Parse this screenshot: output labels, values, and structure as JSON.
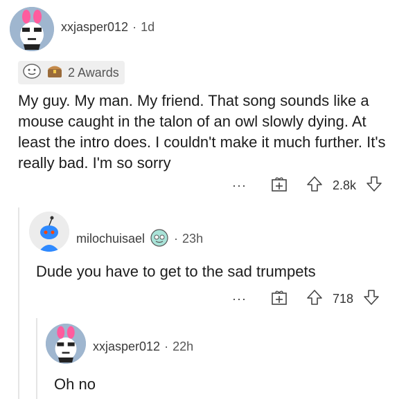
{
  "comments": [
    {
      "username": "xxjasper012",
      "separator": "·",
      "time": "1d",
      "awards_label": "2 Awards",
      "body": "My guy. My man. My friend. That song sounds like a mouse caught in the talon of an owl slowly dying. At least the intro does. I couldn't make it much further. It's really bad. I'm so sorry",
      "more": "···",
      "score": "2.8k"
    },
    {
      "username": "milochuisael",
      "separator": "·",
      "time": "23h",
      "body": "Dude you have to get to the sad trumpets",
      "more": "···",
      "score": "718"
    },
    {
      "username": "xxjasper012",
      "separator": "·",
      "time": "22h",
      "body": "Oh no"
    }
  ]
}
